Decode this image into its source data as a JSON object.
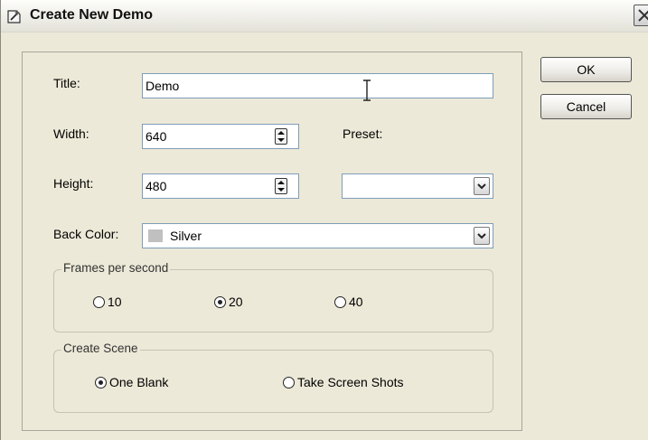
{
  "dialog": {
    "title": "Create New Demo"
  },
  "form": {
    "title_label": "Title:",
    "title_value": "Demo",
    "width_label": "Width:",
    "width_value": "640",
    "height_label": "Height:",
    "height_value": "480",
    "preset_label": "Preset:",
    "preset_value": "",
    "back_color_label": "Back Color:",
    "back_color_value": "Silver",
    "back_color_swatch": "#c0c0c0"
  },
  "fps_group": {
    "label": "Frames per second",
    "options": [
      "10",
      "20",
      "40"
    ],
    "selected": "20"
  },
  "scene_group": {
    "label": "Create Scene",
    "options": [
      "One Blank",
      "Take Screen Shots"
    ],
    "selected": "One Blank"
  },
  "buttons": {
    "ok": "OK",
    "cancel": "Cancel"
  },
  "icons": {
    "title": "wand-icon",
    "close": "close-icon",
    "spinner": "spinner-icon",
    "dropdown": "chevron-down-icon"
  },
  "colors": {
    "dialog_bg": "#ece9d8",
    "input_border": "#7f9db9"
  }
}
